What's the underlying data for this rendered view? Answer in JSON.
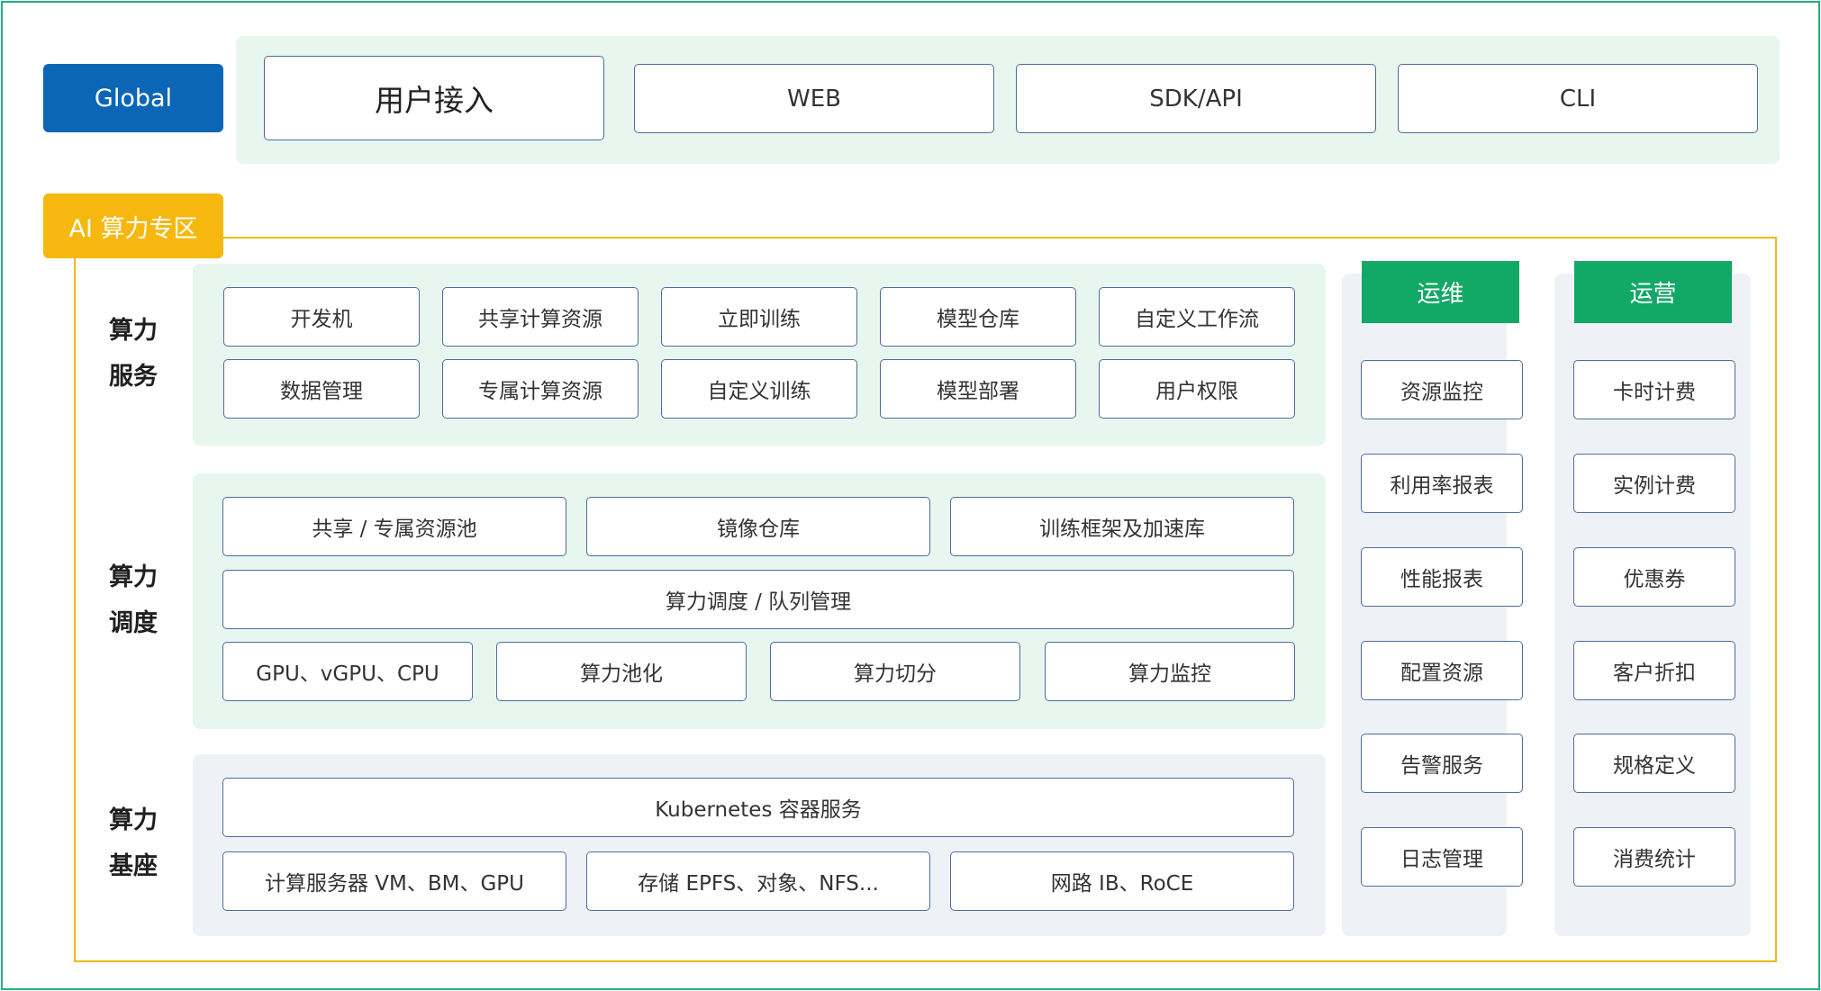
{
  "global": {
    "tag": "Global",
    "access_title": "用户接入",
    "items": [
      "WEB",
      "SDK/API",
      "CLI"
    ]
  },
  "zone": {
    "tag": "AI 算力专区",
    "service": {
      "label": [
        "算力",
        "服务"
      ],
      "row1": [
        "开发机",
        "共享计算资源",
        "立即训练",
        "模型仓库",
        "自定义工作流"
      ],
      "row2": [
        "数据管理",
        "专属计算资源",
        "自定义训练",
        "模型部署",
        "用户权限"
      ]
    },
    "schedule": {
      "label": [
        "算力",
        "调度"
      ],
      "row1": [
        "共享 / 专属资源池",
        "镜像仓库",
        "训练框架及加速库"
      ],
      "row2": "算力调度 / 队列管理",
      "row3": [
        "GPU、vGPU、CPU",
        "算力池化",
        "算力切分",
        "算力监控"
      ]
    },
    "base": {
      "label": [
        "算力",
        "基座"
      ],
      "row1": "Kubernetes 容器服务",
      "row2": [
        "计算服务器 VM、BM、GPU",
        "存储 EPFS、对象、NFS...",
        "网路 IB、RoCE"
      ]
    },
    "ops": {
      "title": "运维",
      "items": [
        "资源监控",
        "利用率报表",
        "性能报表",
        "配置资源",
        "告警服务",
        "日志管理"
      ]
    },
    "operation": {
      "title": "运营",
      "items": [
        "卡时计费",
        "实例计费",
        "优惠券",
        "客户折扣",
        "规格定义",
        "消费统计"
      ]
    }
  },
  "colors": {
    "frame": "#22b07a",
    "global_tag": "#0b66b8",
    "zone_tag": "#f6b80f",
    "panel_green": "#e7f6ef",
    "panel_gray": "#eef2f6",
    "header_green": "#12a866",
    "box_border": "#4f6c9a"
  }
}
